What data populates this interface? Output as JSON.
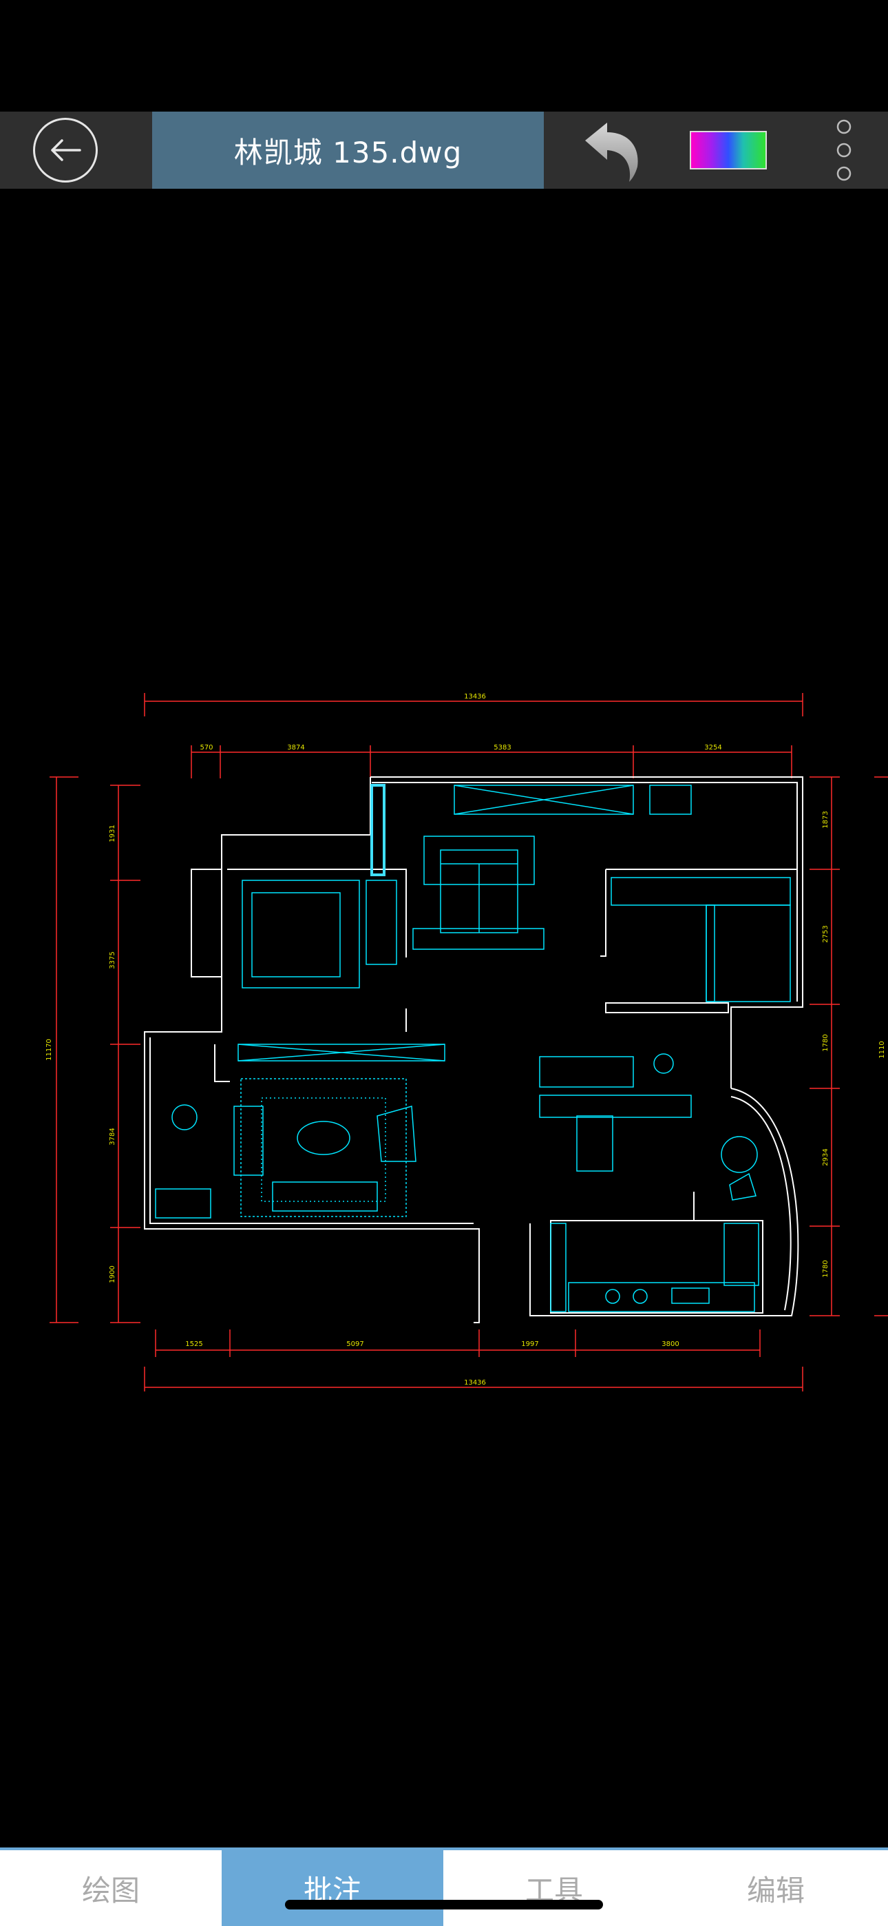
{
  "toolbar": {
    "title": "林凯城 135.dwg",
    "back_icon": "back-arrow-circle-icon",
    "undo_icon": "undo-icon",
    "color_picker_icon": "color-spectrum-icon",
    "more_icon": "vertical-dots-icon"
  },
  "drawing": {
    "dim_top_total": "13436",
    "dim_top_segments": [
      "570",
      "3874",
      "5383",
      "3254"
    ],
    "dim_bottom_segments": [
      "1525",
      "5097",
      "1997",
      "3800"
    ],
    "dim_bottom_total": "13436",
    "dim_left_total": "11170",
    "dim_left_segments": [
      "1931",
      "3375",
      "3784",
      "1900"
    ],
    "dim_right_segments": [
      "1873",
      "2753",
      "1780",
      "2934",
      "1780"
    ],
    "dim_right_total": "1110",
    "colors": {
      "dimension": "#ff2a2a",
      "text": "#e6e600",
      "wall": "#ffffff",
      "furniture": "#00e5ff"
    }
  },
  "tabs": [
    {
      "label": "绘图",
      "active": false
    },
    {
      "label": "批注",
      "active": true
    },
    {
      "label": "工具",
      "active": false
    },
    {
      "label": "编辑",
      "active": false
    }
  ]
}
